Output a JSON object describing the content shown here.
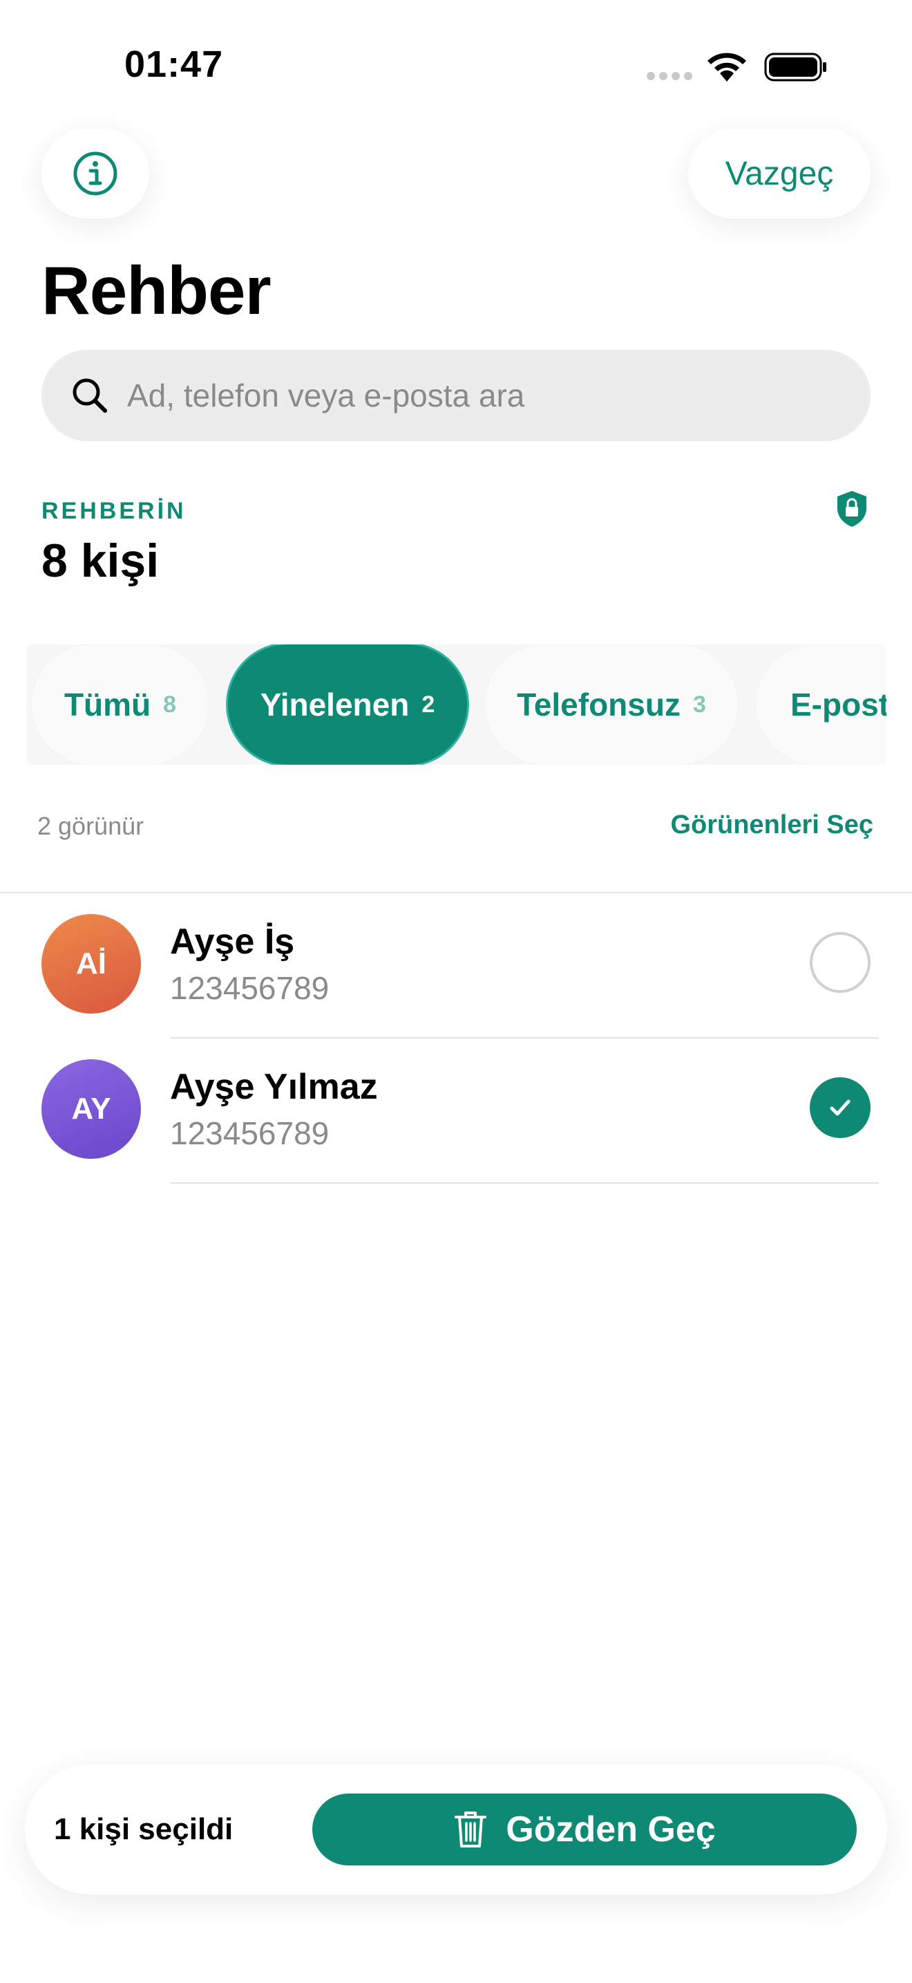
{
  "status_bar": {
    "time": "01:47"
  },
  "header": {
    "cancel_label": "Vazgeç",
    "title": "Rehber"
  },
  "search": {
    "placeholder": "Ad, telefon veya e-posta ara"
  },
  "summary": {
    "section_label": "REHBERİN",
    "count_label": "8 kişi"
  },
  "filters": [
    {
      "label": "Tümü",
      "count": "8",
      "active": false
    },
    {
      "label": "Yinelenen",
      "count": "2",
      "active": true
    },
    {
      "label": "Telefonsuz",
      "count": "3",
      "active": false
    },
    {
      "label": "E-post",
      "count": "",
      "active": false
    }
  ],
  "list_header": {
    "visible_count": "2 görünür",
    "select_visible_label": "Görünenleri Seç"
  },
  "contacts": [
    {
      "initials": "Aİ",
      "name": "Ayşe İş",
      "phone": "123456789",
      "selected": false,
      "avatar_colors": [
        "#ee8a4a",
        "#d9583f"
      ]
    },
    {
      "initials": "AY",
      "name": "Ayşe Yılmaz",
      "phone": "123456789",
      "selected": true,
      "avatar_colors": [
        "#8a67e2",
        "#6a47c9"
      ]
    }
  ],
  "bottom_bar": {
    "selected_label": "1 kişi seçildi",
    "review_label": "Gözden Geç"
  },
  "colors": {
    "accent": "#0e8a74",
    "accent_light": "#86c7b8"
  }
}
